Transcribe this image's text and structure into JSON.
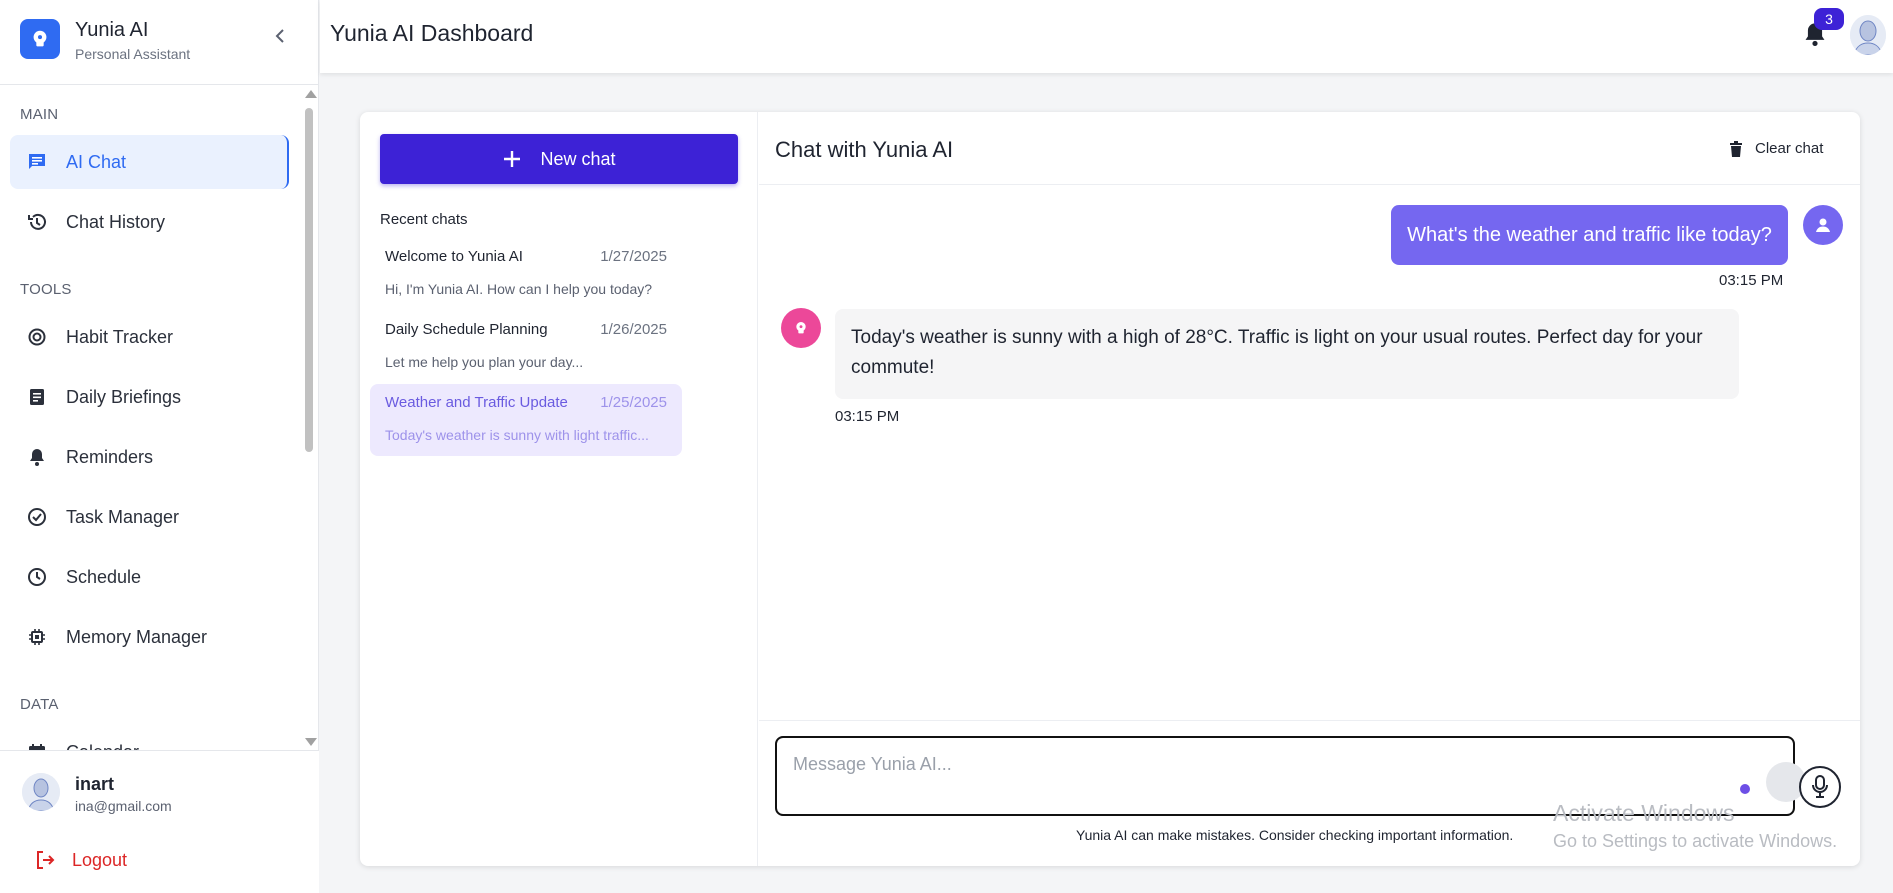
{
  "brand": {
    "name": "Yunia AI",
    "subtitle": "Personal Assistant"
  },
  "sidebar": {
    "sections": [
      {
        "title": "MAIN"
      },
      {
        "title": "TOOLS"
      },
      {
        "title": "DATA"
      }
    ],
    "items": [
      {
        "label": "AI Chat",
        "icon": "chat-icon",
        "active": true
      },
      {
        "label": "Chat History",
        "icon": "history-icon"
      },
      {
        "label": "Habit Tracker",
        "icon": "habit-icon"
      },
      {
        "label": "Daily Briefings",
        "icon": "document-icon"
      },
      {
        "label": "Reminders",
        "icon": "bell-icon"
      },
      {
        "label": "Task Manager",
        "icon": "check-circle-icon"
      },
      {
        "label": "Schedule",
        "icon": "clock-icon"
      },
      {
        "label": "Memory Manager",
        "icon": "chip-icon"
      },
      {
        "label": "Calendar",
        "icon": "calendar-icon"
      }
    ]
  },
  "user": {
    "name": "inart",
    "email": "ina@gmail.com"
  },
  "logout_label": "Logout",
  "header": {
    "title": "Yunia AI Dashboard",
    "notification_count": "3"
  },
  "chat_list": {
    "new_chat_label": "New chat",
    "recent_title": "Recent chats",
    "items": [
      {
        "title": "Welcome to Yunia AI",
        "date": "1/27/2025",
        "preview": "Hi, I'm Yunia AI. How can I help you today?"
      },
      {
        "title": "Daily Schedule Planning",
        "date": "1/26/2025",
        "preview": "Let me help you plan your day..."
      },
      {
        "title": "Weather and Traffic Update",
        "date": "1/25/2025",
        "preview": "Today's weather is sunny with light traffic...",
        "active": true
      }
    ]
  },
  "conversation": {
    "title": "Chat with Yunia AI",
    "clear_label": "Clear chat",
    "messages": [
      {
        "role": "user",
        "text": "What's the weather and traffic like today?",
        "time": "03:15 PM"
      },
      {
        "role": "assistant",
        "text": "Today's weather is sunny with a high of 28°C. Traffic is light on your usual routes. Perfect day for your commute!",
        "time": "03:15 PM"
      }
    ],
    "input_placeholder": "Message Yunia AI...",
    "disclaimer": "Yunia AI can make mistakes. Consider checking important information."
  },
  "watermark": {
    "line1": "Activate Windows",
    "line2": "Go to Settings to activate Windows."
  },
  "colors": {
    "primary": "#3d22d6",
    "accent_blue": "#2f6bf2",
    "user_bubble": "#7567f0",
    "bot_avatar": "#ec4899",
    "logout": "#dc2626"
  }
}
